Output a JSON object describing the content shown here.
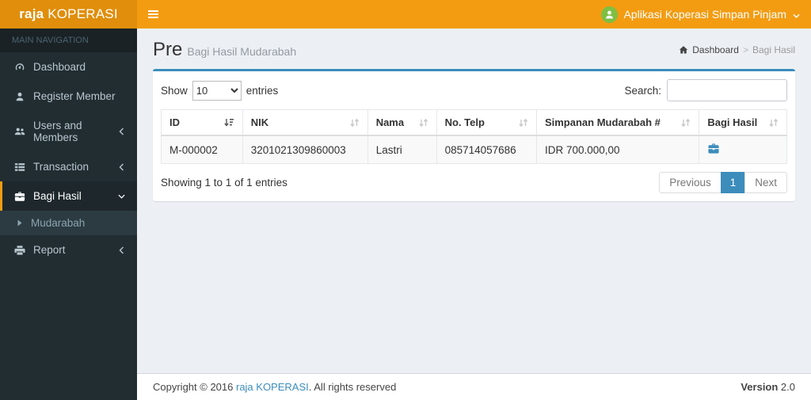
{
  "header": {
    "logo_bold": "raja",
    "logo_rest": " KOPERASI",
    "user_menu_label": "Aplikasi Koperasi Simpan Pinjam"
  },
  "sidebar": {
    "section_label": "MAIN NAVIGATION",
    "items": [
      {
        "label": "Dashboard",
        "icon": "dashboard-icon"
      },
      {
        "label": "Register Member",
        "icon": "user-icon"
      },
      {
        "label": "Users and Members",
        "icon": "users-icon"
      },
      {
        "label": "Transaction",
        "icon": "list-icon"
      },
      {
        "label": "Bagi Hasil",
        "icon": "briefcase-icon"
      },
      {
        "label": "Report",
        "icon": "printer-icon"
      }
    ],
    "submenu": {
      "label": "Mudarabah"
    }
  },
  "page": {
    "title": "Pre",
    "subtitle": "Bagi Hasil Mudarabah",
    "breadcrumb_home": "Dashboard",
    "breadcrumb_separator": ">",
    "breadcrumb_current": "Bagi Hasil"
  },
  "controls": {
    "show_label": "Show",
    "page_length": "10",
    "entries_label": "entries",
    "search_label": "Search:"
  },
  "table": {
    "columns": [
      "ID",
      "NIK",
      "Nama",
      "No. Telp",
      "Simpanan Mudarabah #",
      "Bagi Hasil"
    ],
    "rows": [
      {
        "id": "M-000002",
        "nik": "3201021309860003",
        "nama": "Lastri",
        "telp": "085714057686",
        "simpanan": "IDR 700.000,00",
        "action": "briefcase-icon"
      }
    ]
  },
  "table_footer": {
    "info": "Showing 1 to 1 of 1 entries",
    "pagination": {
      "previous": "Previous",
      "page": "1",
      "next": "Next"
    }
  },
  "footer": {
    "copyright_prefix": "Copyright © 2016 ",
    "brand_link": "raja KOPERASI",
    "copyright_suffix": ". All rights reserved",
    "version_label": "Version ",
    "version_value": "2.0"
  },
  "colors": {
    "navbar": "#f39c12",
    "logo_bg": "#e08e0b",
    "sidebar_bg": "#222d32",
    "accent_blue": "#3c8dbc",
    "avatar_green": "#7ebf42",
    "content_bg": "#ecf0f5"
  }
}
